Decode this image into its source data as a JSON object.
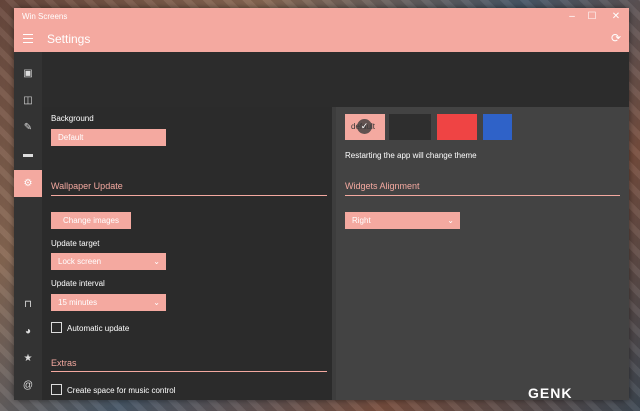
{
  "window": {
    "title": "Win Screens",
    "minimize": "–",
    "maximize": "☐",
    "close": "✕"
  },
  "header": {
    "title": "Settings",
    "refresh_icon": "refresh-icon"
  },
  "sidebar": {
    "items": [
      {
        "icon": "image-icon",
        "glyph": "▣"
      },
      {
        "icon": "gallery-icon",
        "glyph": "◫"
      },
      {
        "icon": "edit-icon",
        "glyph": "✎"
      },
      {
        "icon": "panel-icon",
        "glyph": "▬"
      },
      {
        "icon": "gear-icon",
        "glyph": "⚙"
      },
      {
        "icon": "store-icon",
        "glyph": "⊓"
      },
      {
        "icon": "person-icon",
        "glyph": "◕"
      },
      {
        "icon": "star-icon",
        "glyph": "★"
      },
      {
        "icon": "at-icon",
        "glyph": "@"
      }
    ]
  },
  "settings": {
    "background_label": "Background",
    "background_value": "Default",
    "wallpaper_section": "Wallpaper Update",
    "change_images_label": "Change images",
    "update_target_label": "Update target",
    "update_target_value": "Lock screen",
    "update_interval_label": "Update interval",
    "update_interval_value": "15 minutes",
    "automatic_update_label": "Automatic update",
    "extras_section": "Extras",
    "music_control_label": "Create space for music control"
  },
  "theme": {
    "swatches": [
      {
        "label": "default",
        "color": "#f4a9a0",
        "selected": true
      },
      {
        "label": "",
        "color": "#2e2e2e",
        "selected": false
      },
      {
        "label": "",
        "color": "#ef4444",
        "selected": false
      },
      {
        "label": "",
        "color": "#2f62c8",
        "selected": false
      }
    ],
    "restart_note": "Restarting the app will change theme"
  },
  "widgets": {
    "section": "Widgets Alignment",
    "alignment_value": "Right"
  },
  "watermark": "GENK"
}
